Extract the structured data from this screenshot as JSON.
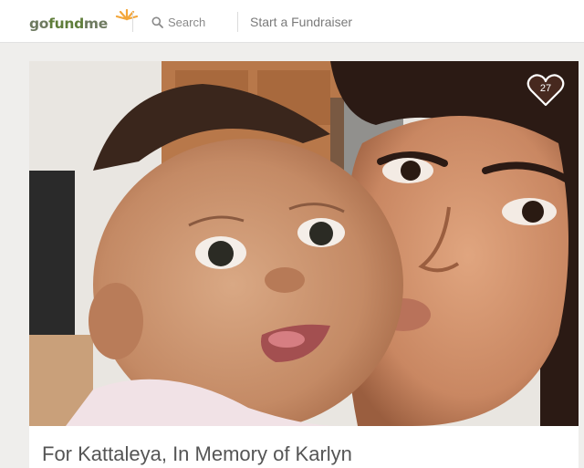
{
  "header": {
    "logo": {
      "part1": "go",
      "part2": "fund",
      "part3": "me"
    },
    "search_label": "Search",
    "start_fundraiser_label": "Start a Fundraiser"
  },
  "campaign": {
    "image_alt": "Photo of a woman kissing a baby's cheek",
    "heart_count": "27",
    "title": "For Kattaleya, In Memory of Karlyn"
  },
  "colors": {
    "brand_green": "#5f7d3a",
    "logo_sun": "#f3a63a",
    "badge_bg": "#5a3326"
  },
  "icons": {
    "search": "search-icon",
    "heart": "heart-icon"
  }
}
